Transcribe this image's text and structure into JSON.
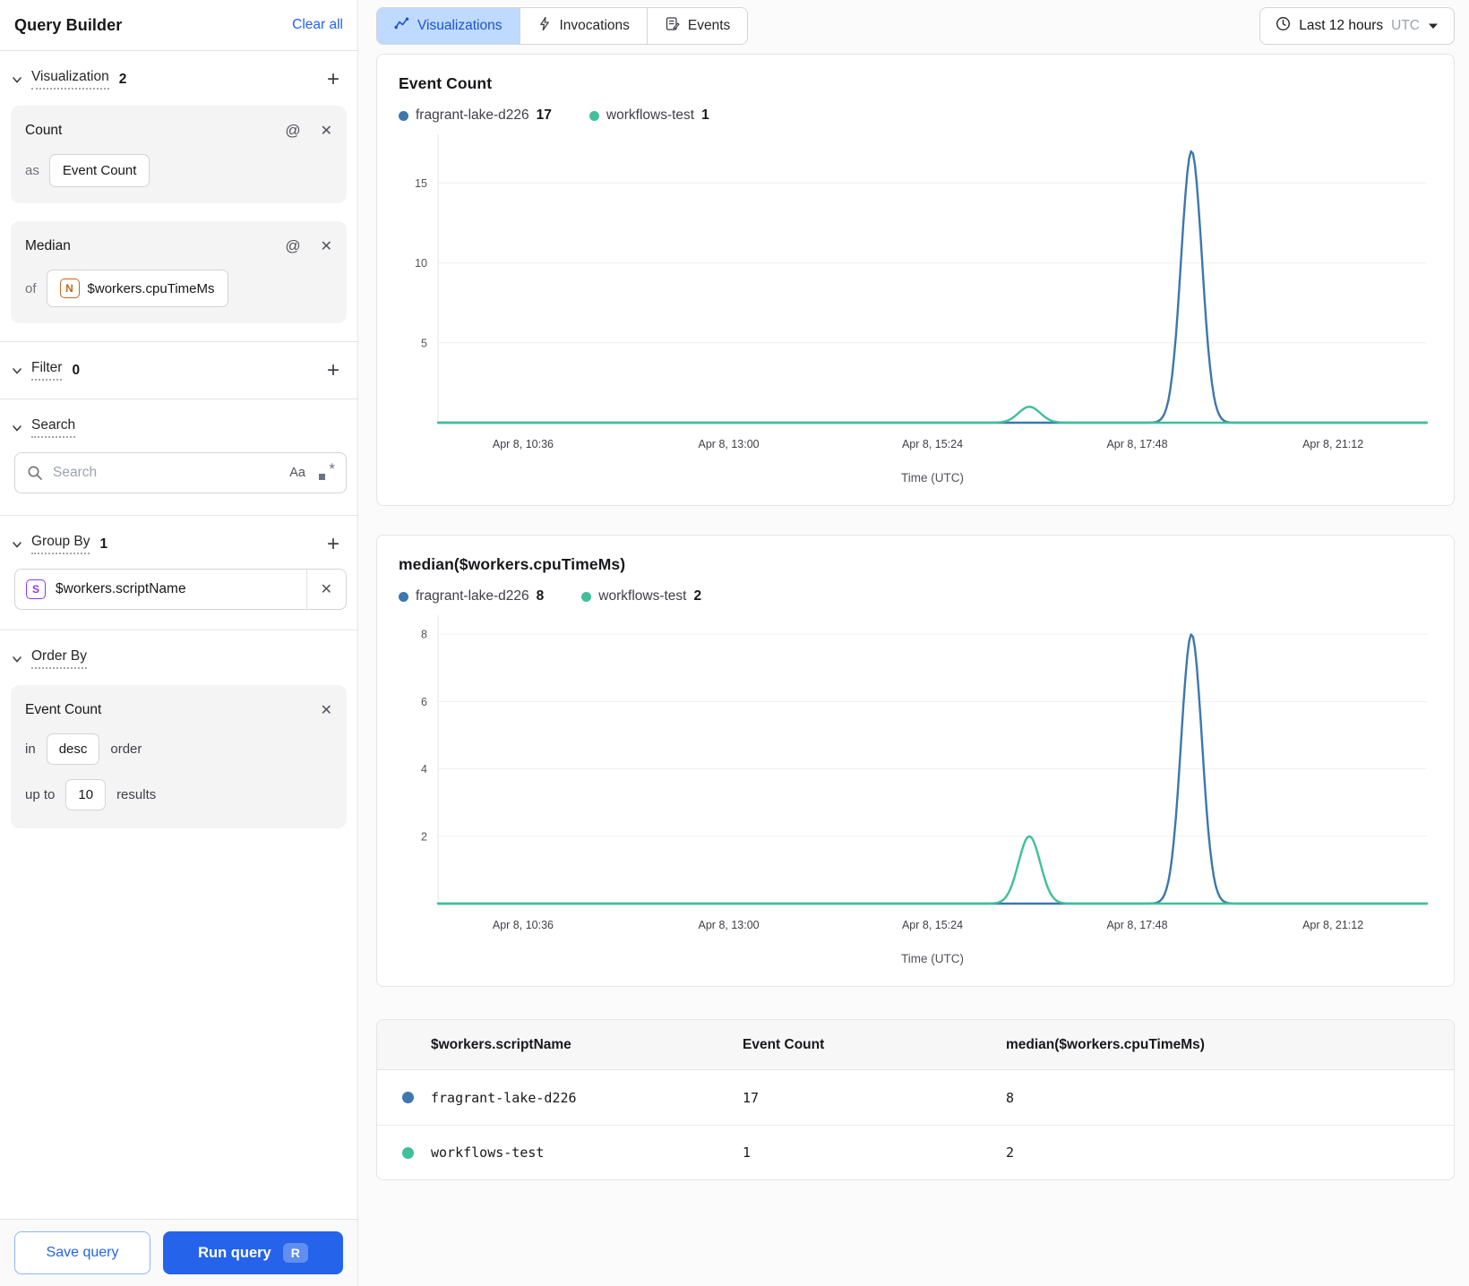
{
  "sidebar": {
    "title": "Query Builder",
    "clear_all": "Clear all",
    "visualization": {
      "label": "Visualization",
      "count": "2"
    },
    "count_card": {
      "title": "Count",
      "as_label": "as",
      "value": "Event Count"
    },
    "median_card": {
      "title": "Median",
      "of_label": "of",
      "field_type": "N",
      "value": "$workers.cpuTimeMs"
    },
    "filter": {
      "label": "Filter",
      "count": "0"
    },
    "search": {
      "label": "Search",
      "placeholder": "Search",
      "case_icon": "Aa",
      "regex_asterisk": "*"
    },
    "group_by": {
      "label": "Group By",
      "count": "1",
      "field_type": "S",
      "value": "$workers.scriptName"
    },
    "order_by": {
      "label": "Order By",
      "field": "Event Count",
      "in_label": "in",
      "direction": "desc",
      "order_label": "order",
      "up_to_label": "up to",
      "limit": "10",
      "results_label": "results"
    },
    "save_button": "Save query",
    "run_button": "Run query",
    "run_shortcut": "R",
    "icons": {
      "at": "@",
      "close": "✕",
      "plus": "+"
    }
  },
  "header": {
    "tabs": [
      {
        "label": "Visualizations",
        "active": true
      },
      {
        "label": "Invocations",
        "active": false
      },
      {
        "label": "Events",
        "active": false
      }
    ],
    "time_range": {
      "label": "Last 12 hours",
      "timezone": "UTC"
    }
  },
  "chart_data": [
    {
      "type": "line",
      "title": "Event Count",
      "xlabel": "Time (UTC)",
      "x_ticks": [
        "Apr 8, 10:36",
        "Apr 8, 13:00",
        "Apr 8, 15:24",
        "Apr 8, 17:48",
        "Apr 8, 21:12"
      ],
      "x_tick_fracs": [
        0.086,
        0.294,
        0.5,
        0.707,
        0.905
      ],
      "y_ticks": [
        5,
        10,
        15
      ],
      "ylim": [
        0,
        17.6
      ],
      "grid": true,
      "legend_position": "top",
      "legend": [
        {
          "name": "fragrant-lake-d226",
          "value": 17,
          "color": "#3c77ad"
        },
        {
          "name": "workflows-test",
          "value": 1,
          "color": "#3fbf9a"
        }
      ],
      "series": [
        {
          "name": "fragrant-lake-d226",
          "color": "#3c77ad",
          "baseline": 0,
          "spikes": [
            {
              "center": 0.762,
              "sigma": 0.0105,
              "peak": 17
            }
          ]
        },
        {
          "name": "workflows-test",
          "color": "#3fbf9a",
          "baseline": 0,
          "spikes": [
            {
              "center": 0.598,
              "sigma": 0.011,
              "peak": 1
            }
          ]
        }
      ]
    },
    {
      "type": "line",
      "title": "median($workers.cpuTimeMs)",
      "xlabel": "Time (UTC)",
      "x_ticks": [
        "Apr 8, 10:36",
        "Apr 8, 13:00",
        "Apr 8, 15:24",
        "Apr 8, 17:48",
        "Apr 8, 21:12"
      ],
      "x_tick_fracs": [
        0.086,
        0.294,
        0.5,
        0.707,
        0.905
      ],
      "y_ticks": [
        2,
        4,
        6,
        8
      ],
      "ylim": [
        0,
        8.35
      ],
      "grid": true,
      "legend_position": "top",
      "legend": [
        {
          "name": "fragrant-lake-d226",
          "value": 8,
          "color": "#3c77ad"
        },
        {
          "name": "workflows-test",
          "value": 2,
          "color": "#3fbf9a"
        }
      ],
      "series": [
        {
          "name": "fragrant-lake-d226",
          "color": "#3c77ad",
          "baseline": 0,
          "spikes": [
            {
              "center": 0.762,
              "sigma": 0.0105,
              "peak": 8
            }
          ]
        },
        {
          "name": "workflows-test",
          "color": "#3fbf9a",
          "baseline": 0,
          "spikes": [
            {
              "center": 0.598,
              "sigma": 0.011,
              "peak": 2
            }
          ]
        }
      ]
    }
  ],
  "table": {
    "columns": [
      "$workers.scriptName",
      "Event Count",
      "median($workers.cpuTimeMs)"
    ],
    "rows": [
      {
        "color": "#3c77ad",
        "name": "fragrant-lake-d226",
        "event_count": "17",
        "median": "8"
      },
      {
        "color": "#3fbf9a",
        "name": "workflows-test",
        "event_count": "1",
        "median": "2"
      }
    ]
  },
  "colors": {
    "accent": "#2563eb",
    "series_blue": "#3c77ad",
    "series_green": "#3fbf9a"
  }
}
